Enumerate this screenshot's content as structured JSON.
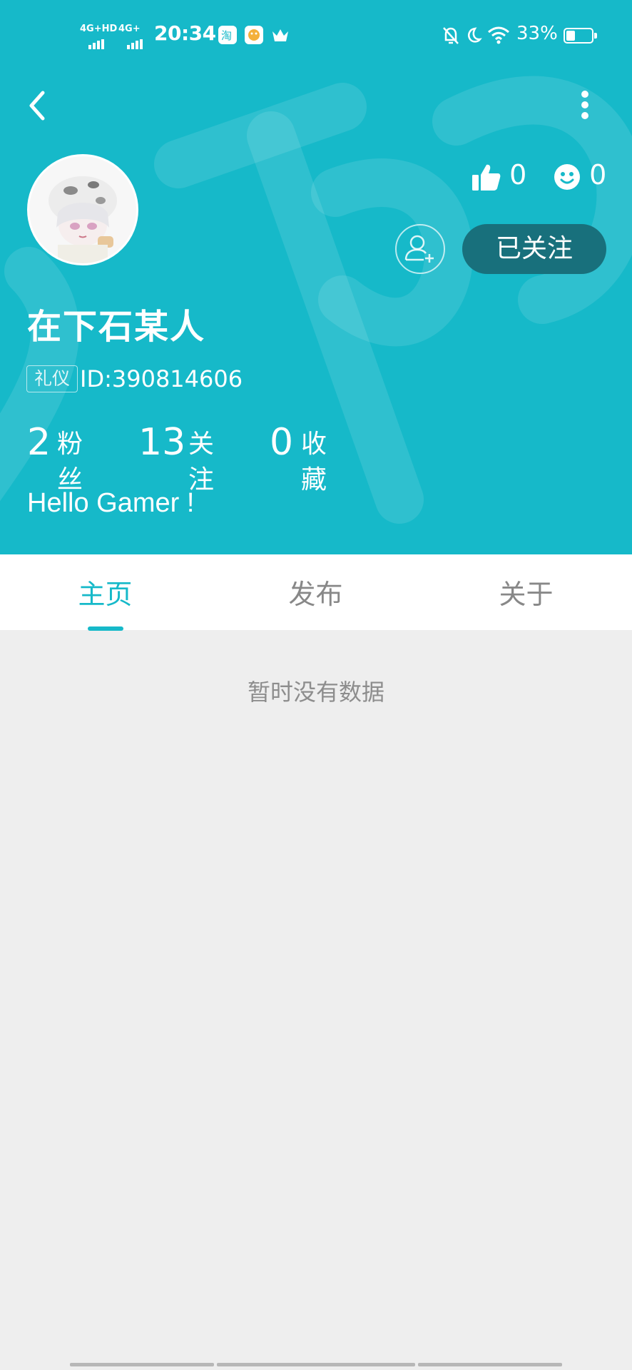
{
  "colors": {
    "accent": "#16b9c9",
    "follow_button_bg": "#18707c",
    "content_bg": "#eeeeee"
  },
  "status_bar": {
    "signal1": "4G+HD",
    "signal2": "4G+",
    "time": "20:34",
    "app_icons": [
      "taobao-icon",
      "game-app-icon",
      "crown-icon"
    ],
    "right_icons": [
      "mute-bell-icon",
      "moon-icon",
      "wifi-icon"
    ],
    "battery": "33%",
    "battery_level": 0.33
  },
  "profile": {
    "username": "在下石某人",
    "badge": "礼仪",
    "id_text": "ID:390814606",
    "likes": "0",
    "emoji_count": "0",
    "follow_label": "已关注",
    "bio": "Hello Gamer !",
    "counts": [
      {
        "value": "2",
        "label": "粉丝"
      },
      {
        "value": "13",
        "label": "关注"
      },
      {
        "value": "0",
        "label": "收藏"
      }
    ]
  },
  "tabs": [
    {
      "label": "主页",
      "active": true
    },
    {
      "label": "发布",
      "active": false
    },
    {
      "label": "关于",
      "active": false
    }
  ],
  "content": {
    "empty_message": "暂时没有数据"
  }
}
